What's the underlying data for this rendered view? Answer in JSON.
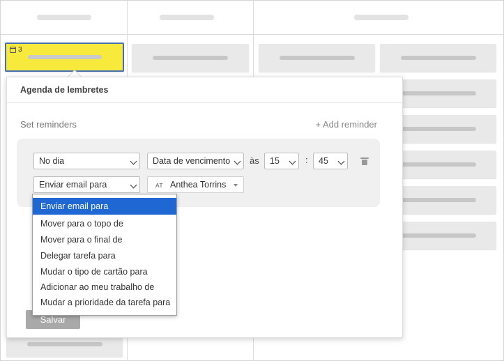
{
  "board": {
    "active_card": {
      "badge_count": "3"
    }
  },
  "modal": {
    "title": "Agenda de lembretes",
    "set_reminders_label": "Set reminders",
    "add_reminder_label": "+ Add reminder",
    "reminder": {
      "when_value": "No dia",
      "date_field_value": "Data de vencimento",
      "at_label": "às",
      "hour_value": "15",
      "time_separator": ":",
      "minute_value": "45",
      "action_value": "Enviar email para",
      "assignee_initials": "AT",
      "assignee_name": "Anthea Torrins"
    },
    "save_label": "Salvar"
  },
  "action_dropdown": {
    "options": [
      "Enviar email para",
      "Mover para o topo de",
      "Mover para o final de",
      "Delegar tarefa para",
      "Mudar o tipo de cartão para",
      "Adicionar ao meu trabalho de",
      "Mudar a prioridade da tarefa para"
    ],
    "selected_index": 0
  },
  "icons": {
    "calendar": "calendar-icon",
    "delete": "trash-icon",
    "chevron": "chevron-down-icon"
  },
  "colors": {
    "active_card_bg": "#f8ea3c",
    "active_card_border": "#4a6fb0",
    "selected_option_bg": "#1f67d2",
    "save_button_bg": "#a9a9a9"
  }
}
